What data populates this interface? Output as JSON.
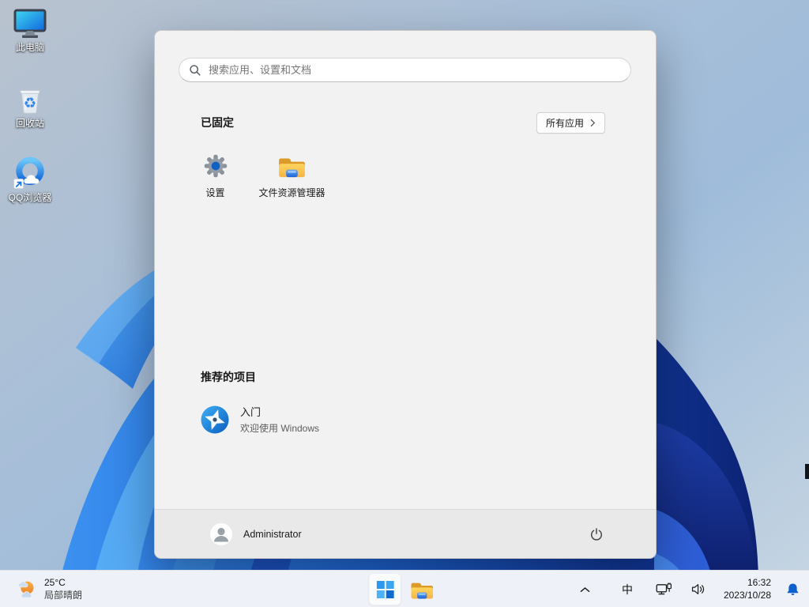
{
  "desktop": {
    "icons": [
      {
        "label": "此电脑"
      },
      {
        "label": "回收站"
      },
      {
        "label": "QQ浏览器"
      }
    ]
  },
  "start_menu": {
    "search_placeholder": "搜索应用、设置和文档",
    "pinned": {
      "title": "已固定",
      "all_apps_label": "所有应用",
      "apps": [
        {
          "label": "设置"
        },
        {
          "label": "文件资源管理器"
        }
      ]
    },
    "recommended": {
      "title": "推荐的项目",
      "items": [
        {
          "title": "入门",
          "subtitle": "欢迎使用 Windows"
        }
      ]
    },
    "footer": {
      "user_name": "Administrator"
    }
  },
  "taskbar": {
    "weather": {
      "temperature": "25°C",
      "condition": "局部晴朗"
    },
    "tray": {
      "ime_label": "中",
      "time": "16:32",
      "date": "2023/10/28"
    }
  },
  "colors": {
    "accent_blue": "#0b5fce",
    "menu_bg": "#f2f2f2",
    "taskbar_bg": "#eef2f8",
    "bell_blue": "#0b5fce",
    "folder_yellow": "#f9b84a"
  }
}
